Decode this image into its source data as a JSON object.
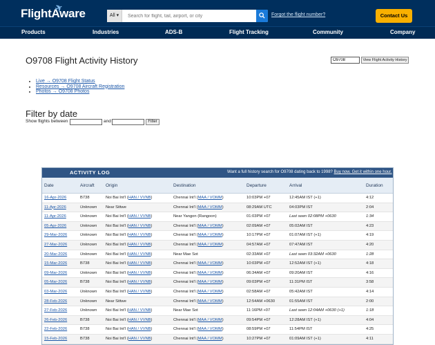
{
  "header": {
    "logo": "FlightAware",
    "search": {
      "filter_label": "All ▾",
      "placeholder": "Search for flight, tail, airport, or city"
    },
    "forgot_link": "Forgot the flight number?",
    "contact_label": "Contact Us"
  },
  "nav": [
    "Products",
    "Industries",
    "ADS-B",
    "Flight Tracking",
    "Community",
    "Company"
  ],
  "page": {
    "title": "O9708 Flight Activity History",
    "tail_input_value": "O9708",
    "view_button": "View Flight Activity History",
    "links": [
      {
        "prefix": "Live",
        "text": "O9708 Flight Status"
      },
      {
        "prefix": "Resources",
        "text": "O9708 Aircraft Registration"
      },
      {
        "prefix": "Photos",
        "text": "O9708 Photos"
      }
    ]
  },
  "filter": {
    "title": "Filter by date",
    "label": "Show flights between",
    "and_label": "and",
    "button": "Filter"
  },
  "activity_log": {
    "title": "ACTIVITY LOG",
    "promo_text": "Want a full history search for O9708 dating back to 1998?",
    "promo_link": "Buy now. Get it within one hour.",
    "columns": [
      "Date",
      "Aircraft",
      "Origin",
      "Destination",
      "Departure",
      "Arrival",
      "Duration"
    ],
    "rows": [
      {
        "date": "16-Apr-2026",
        "aircraft": "B738",
        "origin_name": "Noi Bai Int'l",
        "origin_code": "HAN / VVNB",
        "dest_name": "Chennai Int'l",
        "dest_code": "MAA / VOMM",
        "departure": "10:03PM +07",
        "arrival": "12:45AM IST (+1)",
        "duration": "4:12"
      },
      {
        "date": "11-Apr-2026",
        "aircraft": "Unknown",
        "origin_name": "Near Sittwe",
        "origin_code": "",
        "dest_name": "Chennai Int'l",
        "dest_code": "MAA / VOMM",
        "departure": "08:29AM UTC",
        "arrival": "04:03PM IST",
        "duration": "2:04"
      },
      {
        "date": "11-Apr-2026",
        "aircraft": "Unknown",
        "origin_name": "Noi Bai Int'l",
        "origin_code": "HAN / VVNB",
        "dest_name": "Near Yangon (Rangoon)",
        "dest_code": "",
        "departure": "01:03PM +07",
        "arrival": "Last seen 02:08PM +0630",
        "duration": "1:34"
      },
      {
        "date": "05-Apr-2026",
        "aircraft": "Unknown",
        "origin_name": "Noi Bai Int'l",
        "origin_code": "HAN / VVNB",
        "dest_name": "Chennai Int'l",
        "dest_code": "MAA / VOMM",
        "departure": "02:09AM +07",
        "arrival": "05:02AM IST",
        "duration": "4:23"
      },
      {
        "date": "29-Mar-2026",
        "aircraft": "Unknown",
        "origin_name": "Noi Bai Int'l",
        "origin_code": "HAN / VVNB",
        "dest_name": "Chennai Int'l",
        "dest_code": "MAA / VOMM",
        "departure": "10:17PM +07",
        "arrival": "01:07AM IST (+1)",
        "duration": "4:19"
      },
      {
        "date": "27-Mar-2026",
        "aircraft": "Unknown",
        "origin_name": "Noi Bai Int'l",
        "origin_code": "HAN / VVNB",
        "dest_name": "Chennai Int'l",
        "dest_code": "MAA / VOMM",
        "departure": "04:57AM +07",
        "arrival": "07:47AM IST",
        "duration": "4:20"
      },
      {
        "date": "20-Mar-2026",
        "aircraft": "Unknown",
        "origin_name": "Noi Bai Int'l",
        "origin_code": "HAN / VVNB",
        "dest_name": "Near Mae Sot",
        "dest_code": "",
        "departure": "02:33AM +07",
        "arrival": "Last seen 03:32AM +0630",
        "duration": "1:28"
      },
      {
        "date": "15-Mar-2026",
        "aircraft": "B738",
        "origin_name": "Noi Bai Int'l",
        "origin_code": "HAN / VVNB",
        "dest_name": "Chennai Int'l",
        "dest_code": "MAA / VOMM",
        "departure": "10:03PM +07",
        "arrival": "12:52AM IST (+1)",
        "duration": "4:18"
      },
      {
        "date": "09-Mar-2026",
        "aircraft": "Unknown",
        "origin_name": "Noi Bai Int'l",
        "origin_code": "HAN / VVNB",
        "dest_name": "Chennai Int'l",
        "dest_code": "MAA / VOMM",
        "departure": "06:34AM +07",
        "arrival": "09:20AM IST",
        "duration": "4:16"
      },
      {
        "date": "05-Mar-2026",
        "aircraft": "B738",
        "origin_name": "Noi Bai Int'l",
        "origin_code": "HAN / VVNB",
        "dest_name": "Chennai Int'l",
        "dest_code": "MAA / VOMM",
        "departure": "09:03PM +07",
        "arrival": "11:31PM IST",
        "duration": "3:58"
      },
      {
        "date": "03-Mar-2026",
        "aircraft": "Unknown",
        "origin_name": "Noi Bai Int'l",
        "origin_code": "HAN / VVNB",
        "dest_name": "Chennai Int'l",
        "dest_code": "MAA / VOMM",
        "departure": "02:58AM +07",
        "arrival": "05:42AM IST",
        "duration": "4:14"
      },
      {
        "date": "28-Feb-2026",
        "aircraft": "Unknown",
        "origin_name": "Near Sittwe",
        "origin_code": "",
        "dest_name": "Chennai Int'l",
        "dest_code": "MAA / VOMM",
        "departure": "12:54AM +0630",
        "arrival": "01:55AM IST",
        "duration": "2:00"
      },
      {
        "date": "27-Feb-2026",
        "aircraft": "Unknown",
        "origin_name": "Noi Bai Int'l",
        "origin_code": "HAN / VVNB",
        "dest_name": "Near Mae Sot",
        "dest_code": "",
        "departure": "11:16PM +07",
        "arrival": "Last seen 12:04AM +0630 (+1)",
        "duration": "1:18"
      },
      {
        "date": "26-Feb-2026",
        "aircraft": "B738",
        "origin_name": "Noi Bai Int'l",
        "origin_code": "HAN / VVNB",
        "dest_name": "Chennai Int'l",
        "dest_code": "MAA / VOMM",
        "departure": "09:54PM +07",
        "arrival": "12:28AM IST (+1)",
        "duration": "4:04"
      },
      {
        "date": "22-Feb-2026",
        "aircraft": "B738",
        "origin_name": "Noi Bai Int'l",
        "origin_code": "HAN / VVNB",
        "dest_name": "Chennai Int'l",
        "dest_code": "MAA / VOMM",
        "departure": "08:59PM +07",
        "arrival": "11:54PM IST",
        "duration": "4:25"
      },
      {
        "date": "15-Feb-2026",
        "aircraft": "B738",
        "origin_name": "Noi Bai Int'l",
        "origin_code": "HAN / VVNB",
        "dest_name": "Chennai Int'l",
        "dest_code": "MAA / VOMM",
        "departure": "10:27PM +07",
        "arrival": "01:09AM IST (+1)",
        "duration": "4:11"
      }
    ]
  }
}
